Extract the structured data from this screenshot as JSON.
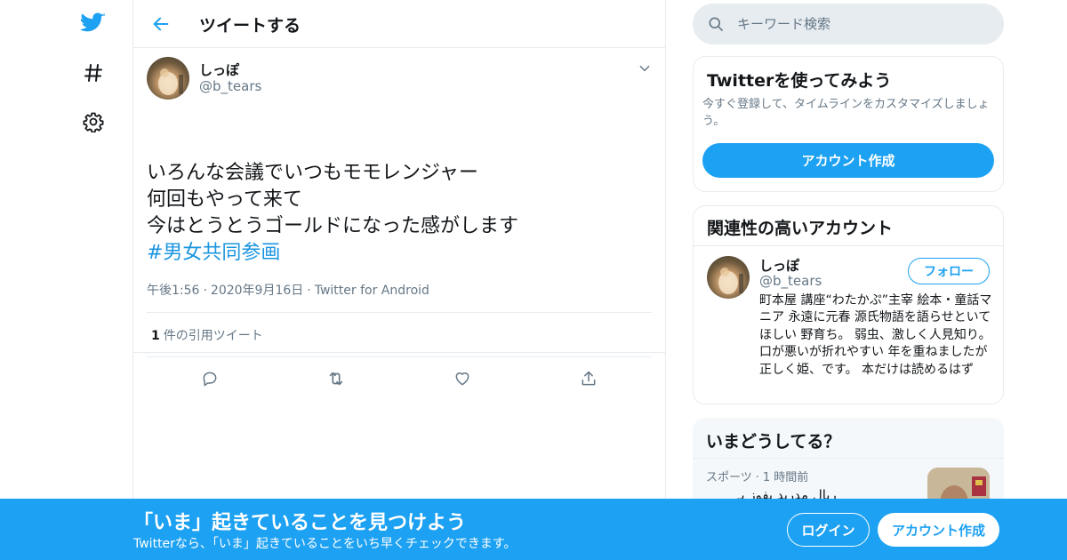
{
  "colors": {
    "accent": "#1da1f2",
    "hashtag": "#1b95e0",
    "secondary_text": "#657786",
    "border": "#e6ecf0"
  },
  "nav": {
    "items": [
      {
        "icon": "twitter-bird-icon"
      },
      {
        "icon": "hashtag-icon"
      },
      {
        "icon": "gear-icon"
      }
    ]
  },
  "header": {
    "title": "ツイートする"
  },
  "tweet": {
    "author_name": "しっぽ",
    "author_handle": "@b_tears",
    "text_lines": [
      "いろんな会議でいつもモモレンジャー",
      "何回もやって来て",
      "今はとうとうゴールドになった感がします"
    ],
    "hashtag": "#男女共同参画",
    "time": "午後1:56",
    "date": "2020年9月16日",
    "source": "Twitter for Android",
    "quote_count": "1",
    "quote_label": "件の引用ツイート"
  },
  "search": {
    "placeholder": "キーワード検索"
  },
  "signup_card": {
    "title": "Twitterを使ってみよう",
    "description": "今すぐ登録して、タイムラインをカスタマイズしましょう。",
    "button": "アカウント作成"
  },
  "related": {
    "title": "関連性の高いアカウント",
    "account": {
      "name": "しっぽ",
      "handle": "@b_tears",
      "follow_label": "フォロー",
      "bio": "町本屋 講座“わたかぷ”主宰 絵本・童話マニア 永遠に元春 源氏物語を語らせといてほしい 野育ち。 弱虫、激しく人見知り。 口が悪いが折れやすい 年を重ねましたが 正しく姫、です。 本だけは読めるはず"
    }
  },
  "trends": {
    "title": "いまどうしてる？",
    "item": {
      "category": "スポーツ",
      "time": "1 時間前",
      "text": "ريال مدريد يفوز بـ"
    }
  },
  "bottom_bar": {
    "title": "「いま」起きていることを見つけよう",
    "subtitle": "Twitterなら、「いま」起きていることをいち早くチェックできます。",
    "login": "ログイン",
    "signup": "アカウント作成"
  }
}
